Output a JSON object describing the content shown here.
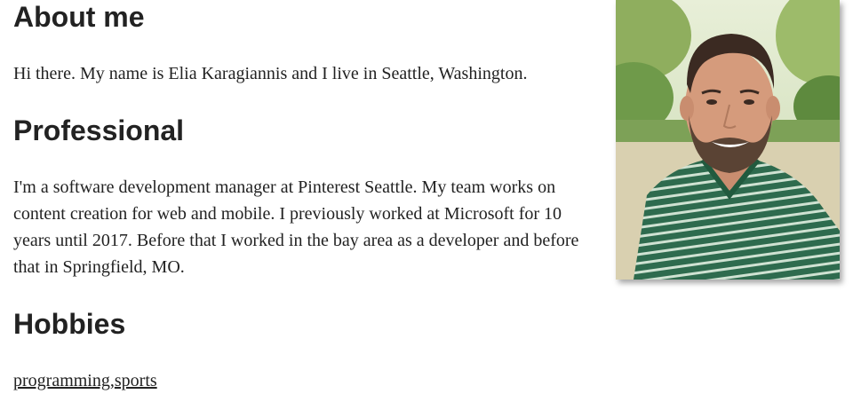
{
  "about": {
    "heading": "About me",
    "intro": "Hi there. My name is Elia Karagiannis and I live in Seattle, Washington."
  },
  "professional": {
    "heading": "Professional",
    "text": "I'm a software development manager at Pinterest Seattle. My team works on content creation for web and mobile. I previously worked at Microsoft for 10 years until 2017. Before that I worked in the bay area as a developer and before that in Springfield, MO."
  },
  "hobbies": {
    "heading": "Hobbies",
    "links": [
      "programming",
      "sports"
    ],
    "separator": ","
  },
  "colors": {
    "text": "#222222",
    "shirt": "#2e6b4e",
    "foliage": "#6f9a4a"
  }
}
